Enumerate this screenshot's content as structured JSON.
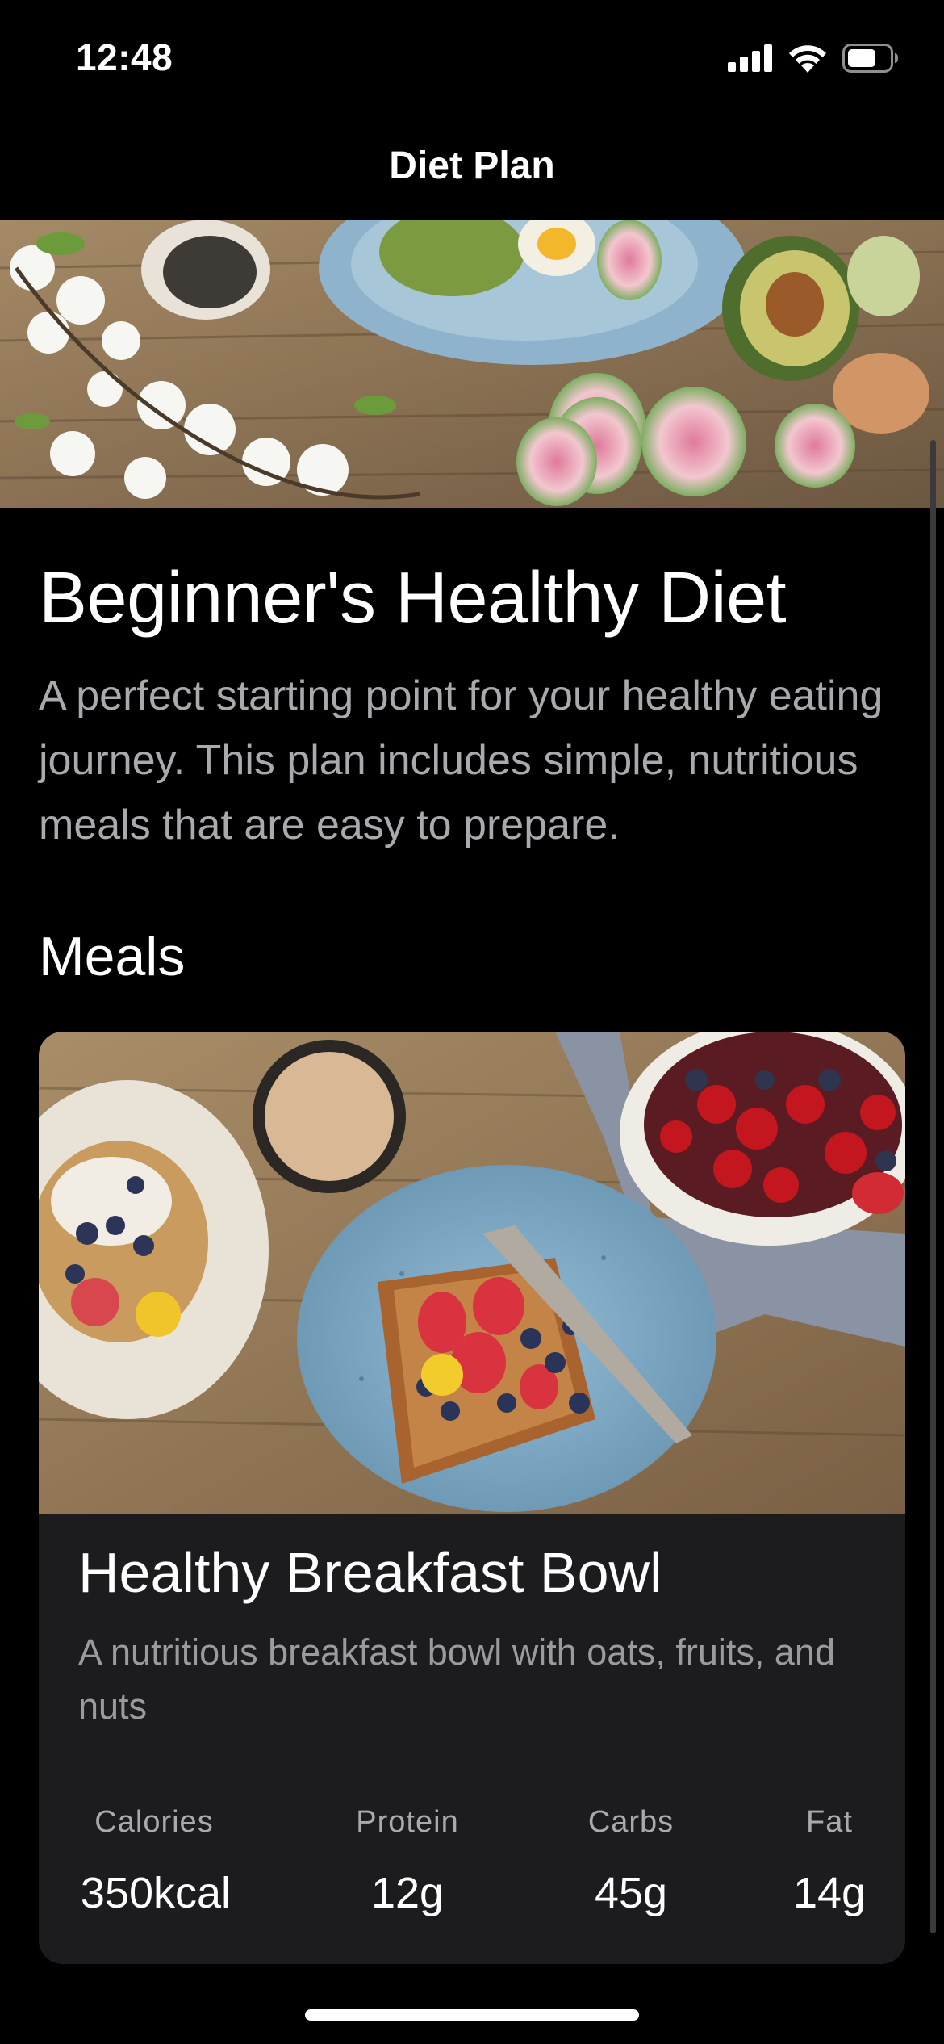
{
  "status_bar": {
    "time": "12:48",
    "icons": [
      "signal-icon",
      "wifi-icon",
      "battery-icon"
    ]
  },
  "nav": {
    "title": "Diet Plan"
  },
  "plan": {
    "title": "Beginner's Healthy Diet",
    "description": "A perfect starting point for your healthy eating journey. This plan includes simple, nutritious meals that are easy to prepare."
  },
  "meals_section": {
    "title": "Meals",
    "meals": [
      {
        "title": "Healthy Breakfast Bowl",
        "description": "A nutritious breakfast bowl with oats, fruits, and nuts",
        "nutrition": [
          {
            "label": "Calories",
            "value": "350kcal"
          },
          {
            "label": "Protein",
            "value": "12g"
          },
          {
            "label": "Carbs",
            "value": "45g"
          },
          {
            "label": "Fat",
            "value": "14g"
          }
        ]
      }
    ]
  },
  "colors": {
    "background": "#000000",
    "card": "#1c1c1e",
    "secondary_text": "#a9a9ae"
  }
}
